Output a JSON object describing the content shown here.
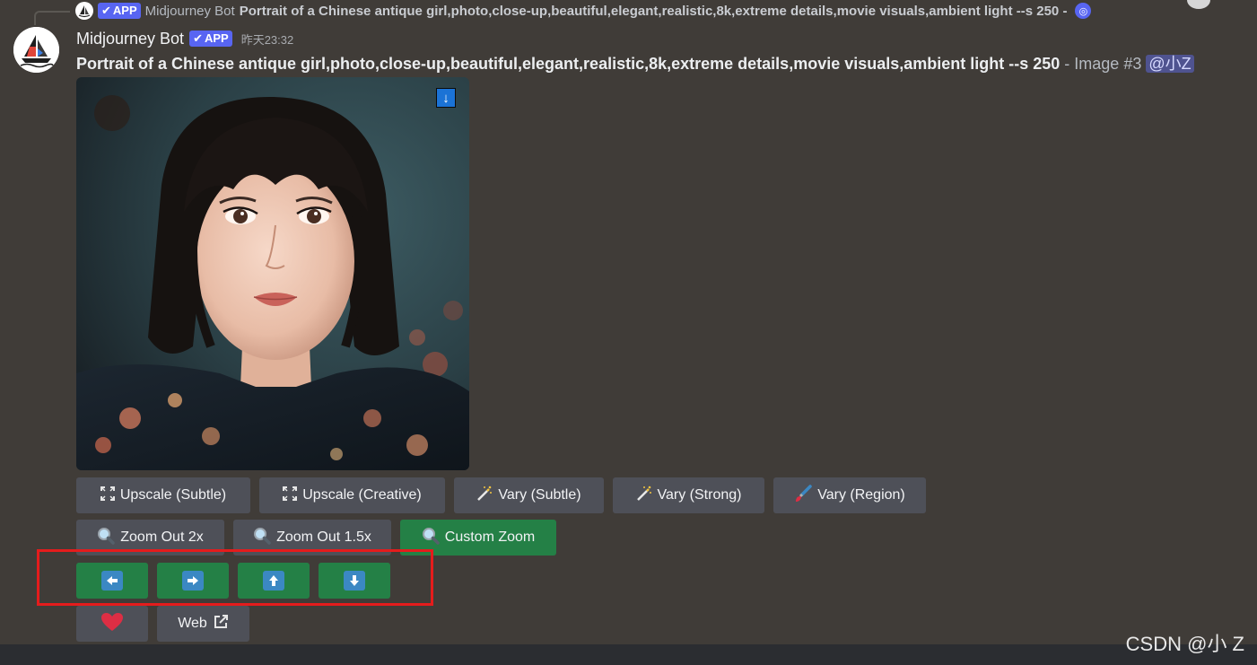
{
  "reply": {
    "badge": "APP",
    "name": "Midjourney Bot",
    "text": "Portrait of a Chinese antique girl,photo,close-up,beautiful,elegant,realistic,8k,extreme details,movie visuals,ambient light --s 250 -"
  },
  "message": {
    "username": "Midjourney Bot",
    "badge": "APP",
    "timestamp": "昨天23:32",
    "prompt": "Portrait of a Chinese antique girl,photo,close-up,beautiful,elegant,realistic,8k,extreme details,movie visuals,ambient light --s 250",
    "suffix": " - Image #3 ",
    "mention": "@小Z"
  },
  "download_icon": "↓",
  "row1": [
    {
      "label": "Upscale (Subtle)",
      "icon": "expand-icon"
    },
    {
      "label": "Upscale (Creative)",
      "icon": "expand-icon"
    },
    {
      "label": "Vary (Subtle)",
      "icon": "magic-wand-icon"
    },
    {
      "label": "Vary (Strong)",
      "icon": "magic-wand-icon"
    },
    {
      "label": "Vary (Region)",
      "icon": "paintbrush-icon"
    }
  ],
  "row2": [
    {
      "label": "Zoom Out 2x",
      "icon": "magnifier-icon"
    },
    {
      "label": "Zoom Out 1.5x",
      "icon": "magnifier-icon"
    },
    {
      "label": "Custom Zoom",
      "icon": "magnifier-icon"
    }
  ],
  "row3_icons": [
    "arrow-left-icon",
    "arrow-right-icon",
    "arrow-up-icon",
    "arrow-down-icon"
  ],
  "row4": {
    "web_label": "Web"
  },
  "watermark": "CSDN @小 Z",
  "colors": {
    "background": "#403c38",
    "button_gray": "#4e5058",
    "button_green": "#248046",
    "highlight": "#e51c1c",
    "badge": "#5865f2"
  }
}
